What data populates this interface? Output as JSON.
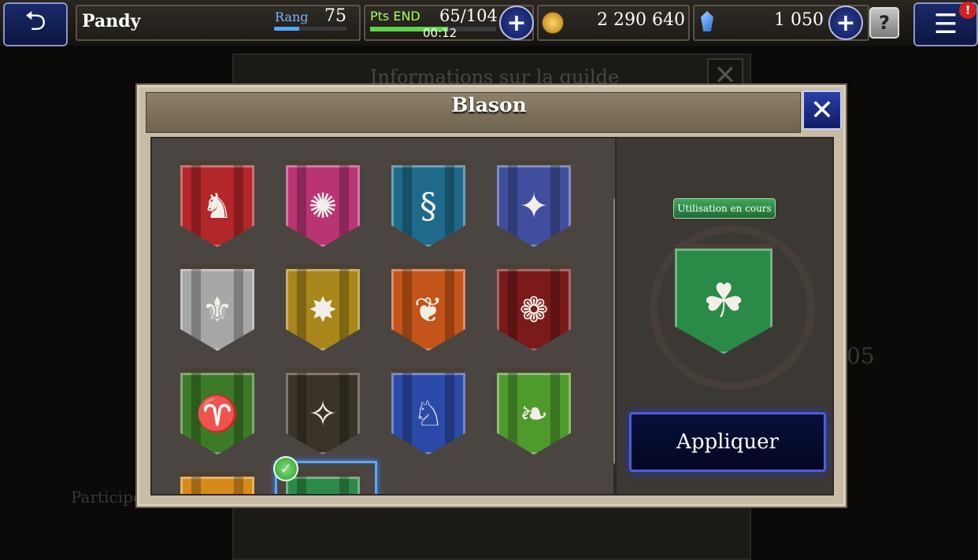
{
  "background": {
    "panel_title": "Informations sur la guilde",
    "side_label": "Participer",
    "side_number": "05"
  },
  "topbar": {
    "player_name": "Pandy",
    "rank_label": "Rang",
    "rank_value": "75",
    "rank_progress": 0.35,
    "end_label": "Pts END",
    "end_value": "65/104",
    "end_progress": 0.62,
    "end_timer": "00:12",
    "gil_value": "2 290 640",
    "crystal_value": "1 050",
    "alert_badge": "!",
    "help_label": "?"
  },
  "modal": {
    "title": "Blason",
    "in_use_label": "Utilisation en cours",
    "apply_label": "Appliquer"
  },
  "crests": [
    {
      "name": "crest-lion",
      "color": "#b3262a",
      "icon": "lion-icon",
      "glyph": "♞"
    },
    {
      "name": "crest-phoenix",
      "color": "#b83473",
      "icon": "phoenix-icon",
      "glyph": "✺"
    },
    {
      "name": "crest-serpent",
      "color": "#1f6a8a",
      "icon": "serpent-icon",
      "glyph": "§"
    },
    {
      "name": "crest-wolf",
      "color": "#3f4f9e",
      "icon": "wolf-icon",
      "glyph": "✦"
    },
    {
      "name": "crest-spear",
      "color": "#a7a7a7",
      "icon": "spear-icon",
      "glyph": "⚜"
    },
    {
      "name": "crest-dragon",
      "color": "#a8861a",
      "icon": "dragon-icon",
      "glyph": "✸"
    },
    {
      "name": "crest-stag",
      "color": "#c45419",
      "icon": "stag-icon",
      "glyph": "❦"
    },
    {
      "name": "crest-rose",
      "color": "#7a1a1a",
      "icon": "rose-icon",
      "glyph": "❁"
    },
    {
      "name": "crest-ram",
      "color": "#3c7a28",
      "icon": "ram-icon",
      "glyph": "♈"
    },
    {
      "name": "crest-bee",
      "color": "#3a3328",
      "icon": "bee-icon",
      "glyph": "✧"
    },
    {
      "name": "crest-knight",
      "color": "#2b4aa8",
      "icon": "knight-icon",
      "glyph": "♘"
    },
    {
      "name": "crest-tree",
      "color": "#4e9a2c",
      "icon": "tree-icon",
      "glyph": "❧"
    },
    {
      "name": "crest-orange",
      "color": "#d78a1a",
      "icon": "partial-icon",
      "glyph": ""
    },
    {
      "name": "crest-green",
      "color": "#2c8a48",
      "icon": "partial-icon",
      "glyph": ""
    }
  ],
  "preview": {
    "color": "#2a8a48",
    "icon": "cactuar-icon",
    "glyph": "☘"
  }
}
